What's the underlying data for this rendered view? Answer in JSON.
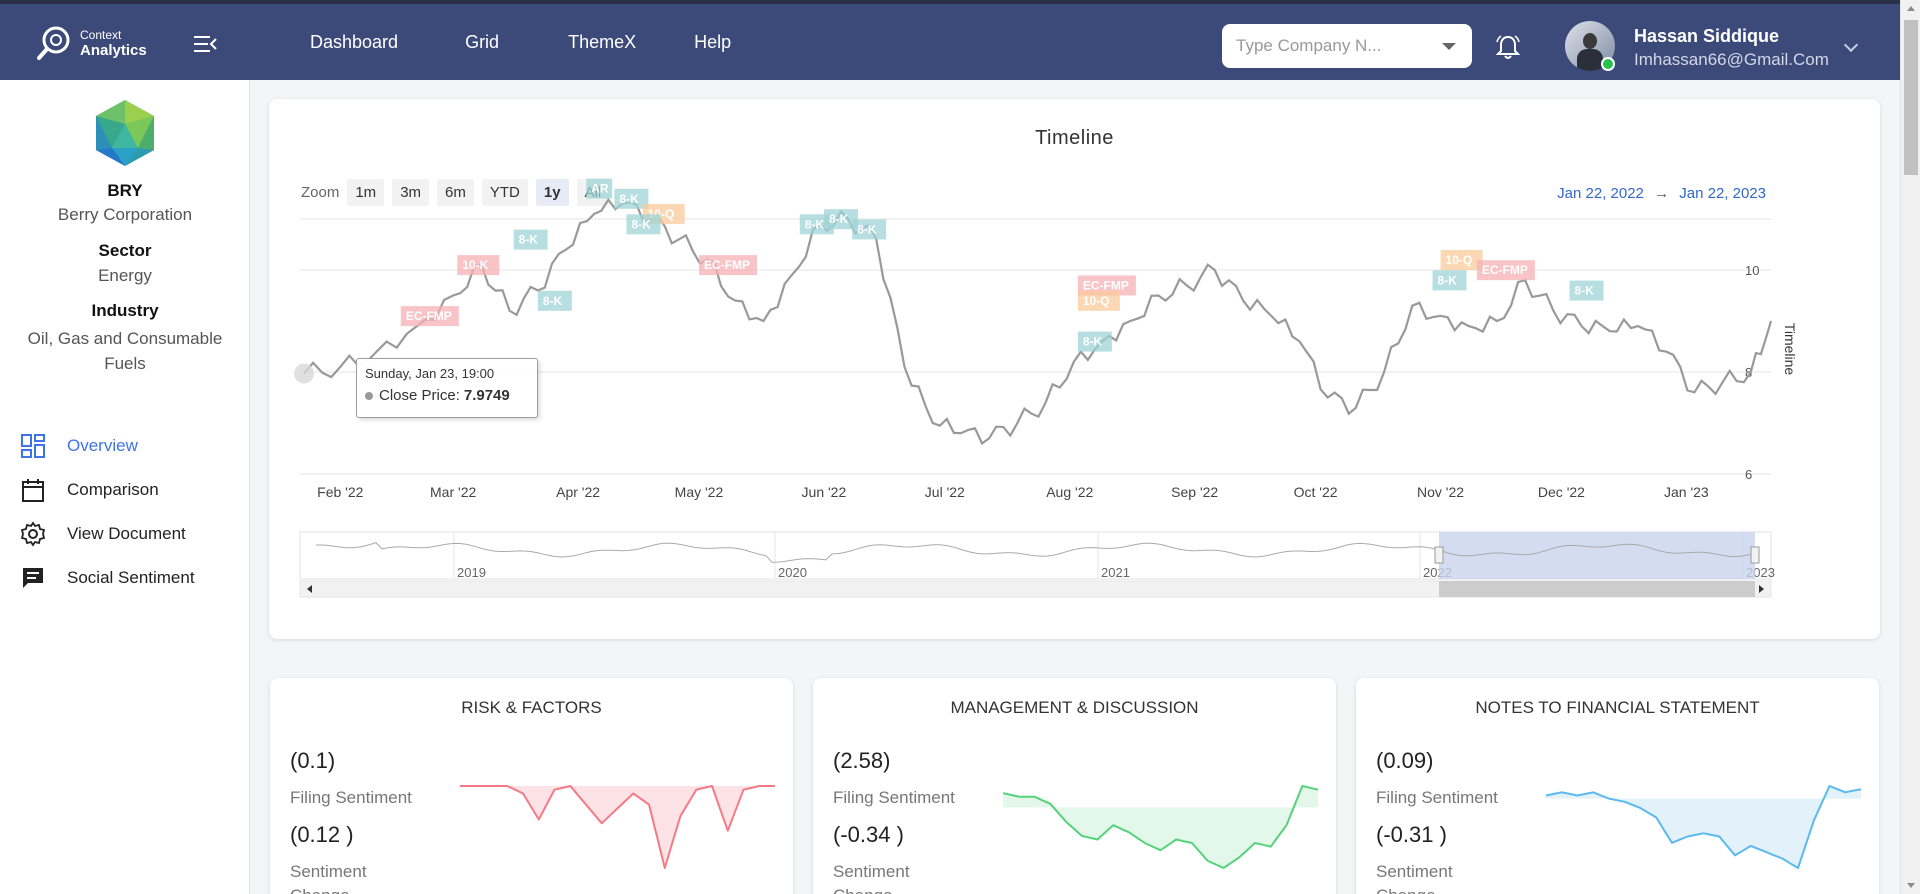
{
  "header": {
    "logo_line1": "Context",
    "logo_line2": "Analytics",
    "nav": [
      "Dashboard",
      "Grid",
      "ThemeX",
      "Help"
    ],
    "company_search_placeholder": "Type Company N...",
    "user_name": "Hassan Siddique",
    "user_email": "Imhassan66@Gmail.Com"
  },
  "sidebar": {
    "ticker": "BRY",
    "company_name": "Berry Corporation",
    "sector_label": "Sector",
    "sector_value": "Energy",
    "industry_label": "Industry",
    "industry_value": "Oil, Gas and Consumable Fuels",
    "menu": [
      {
        "label": "Overview",
        "icon": "dashboard-icon",
        "active": true
      },
      {
        "label": "Comparison",
        "icon": "calendar-icon",
        "active": false
      },
      {
        "label": "View Document",
        "icon": "gear-icon",
        "active": false
      },
      {
        "label": "Social Sentiment",
        "icon": "chat-icon",
        "active": false
      }
    ],
    "accent_color": "#3f74e6"
  },
  "timeline": {
    "title": "Timeline",
    "zoom_label": "Zoom",
    "zoom_options": [
      "1m",
      "3m",
      "6m",
      "YTD",
      "1y",
      "All"
    ],
    "zoom_selected": "1y",
    "range_from": "Jan 22, 2022",
    "range_arrow": "→",
    "range_to": "Jan 22, 2023",
    "tooltip": {
      "date": "Sunday, Jan 23, 19:00",
      "label": "Close Price:",
      "value": "7.9749"
    }
  },
  "chart_data": {
    "type": "line",
    "title": "Timeline",
    "ylabel": "Timeline",
    "ylim": [
      6,
      11
    ],
    "yticks": [
      6,
      8,
      10
    ],
    "xticks": [
      "Feb '22",
      "Mar '22",
      "Apr '22",
      "May '22",
      "Jun '22",
      "Jul '22",
      "Aug '22",
      "Sep '22",
      "Oct '22",
      "Nov '22",
      "Dec '22",
      "Jan '23"
    ],
    "series": [
      {
        "x": [
          "2022-01-23",
          "2022-02-01",
          "2022-02-10",
          "2022-02-20",
          "2022-03-01",
          "2022-03-08",
          "2022-03-15",
          "2022-03-22",
          "2022-03-29",
          "2022-04-05",
          "2022-04-12",
          "2022-04-19",
          "2022-04-26",
          "2022-05-03",
          "2022-05-10",
          "2022-05-17",
          "2022-05-24",
          "2022-05-31",
          "2022-06-07",
          "2022-06-14",
          "2022-06-21",
          "2022-06-28",
          "2022-07-05",
          "2022-07-12",
          "2022-07-19",
          "2022-07-26",
          "2022-08-02",
          "2022-08-09",
          "2022-08-16",
          "2022-08-23",
          "2022-08-30",
          "2022-09-06",
          "2022-09-13",
          "2022-09-20",
          "2022-09-27",
          "2022-10-04",
          "2022-10-11",
          "2022-10-18",
          "2022-10-25",
          "2022-11-01",
          "2022-11-08",
          "2022-11-15",
          "2022-11-22",
          "2022-11-29",
          "2022-12-06",
          "2022-12-13",
          "2022-12-20",
          "2022-12-27",
          "2023-01-03",
          "2023-01-10",
          "2023-01-17",
          "2023-01-22"
        ],
        "y": [
          7.97,
          8.1,
          8.4,
          8.9,
          9.5,
          10.1,
          9.2,
          9.6,
          10.4,
          11.1,
          11.3,
          11.0,
          10.6,
          10.2,
          9.4,
          9.0,
          9.9,
          10.9,
          11.0,
          10.6,
          8.1,
          7.0,
          6.8,
          6.7,
          7.0,
          7.4,
          8.2,
          8.6,
          9.0,
          9.5,
          9.7,
          10.0,
          9.4,
          9.1,
          8.6,
          7.5,
          7.3,
          8.0,
          9.3,
          9.1,
          8.9,
          9.0,
          9.8,
          9.2,
          8.9,
          8.8,
          8.9,
          8.4,
          7.6,
          7.8,
          8.0,
          9.0
        ]
      }
    ],
    "filing_markers": [
      "EC-FMP",
      "10-K",
      "8-K",
      "8-K",
      "AR",
      "8-K",
      "10-Q",
      "8-K",
      "EC-FMP",
      "8-K",
      "8-K",
      "8-K",
      "EC-FMP",
      "10-Q",
      "8-K",
      "8-K",
      "10-Q",
      "EC-FMP",
      "8-K"
    ],
    "navigator_labels": [
      "2019",
      "2020",
      "2021",
      "2022",
      "2023"
    ],
    "line_color": "#999999"
  },
  "sentiment_cards": [
    {
      "title": "RISK & FACTORS",
      "filing_sentiment": "(0.1)",
      "filing_label": "Filing Sentiment",
      "sentiment": "(0.12 )",
      "sentiment_label": "Sentiment",
      "extra_label": "Change",
      "color": "#f57a86",
      "fill": "#fde3e6",
      "spark": [
        0,
        0,
        0,
        0,
        -0.2,
        -0.9,
        -0.1,
        0,
        -0.5,
        -1.0,
        -0.6,
        -0.2,
        -0.5,
        -2.2,
        -0.8,
        -0.1,
        0,
        -1.2,
        -0.1,
        0,
        0
      ]
    },
    {
      "title": "MANAGEMENT & DISCUSSION",
      "filing_sentiment": "(2.58)",
      "filing_label": "Filing Sentiment",
      "sentiment": "(-0.34 )",
      "sentiment_label": "Sentiment",
      "extra_label": "Change",
      "color": "#55d37a",
      "fill": "#e3f7ea",
      "spark": [
        0.4,
        0.3,
        0.3,
        0.1,
        -0.4,
        -0.8,
        -0.9,
        -0.5,
        -0.7,
        -1.0,
        -1.2,
        -0.9,
        -1.0,
        -1.5,
        -1.7,
        -1.4,
        -1.0,
        -1.1,
        -0.5,
        0.6,
        0.5
      ]
    },
    {
      "title": "NOTES TO FINANCIAL STATEMENT",
      "filing_sentiment": "(0.09)",
      "filing_label": "Filing Sentiment",
      "sentiment": "(-0.31 )",
      "sentiment_label": "Sentiment",
      "extra_label": "Change",
      "color": "#5bb9f0",
      "fill": "#e3f1fb",
      "spark": [
        0.1,
        0.2,
        0.1,
        0.2,
        0,
        -0.1,
        -0.3,
        -0.6,
        -1.4,
        -1.2,
        -1.1,
        -1.2,
        -1.8,
        -1.5,
        -1.7,
        -1.9,
        -2.2,
        -0.7,
        0.4,
        0.2,
        0.3
      ]
    }
  ]
}
